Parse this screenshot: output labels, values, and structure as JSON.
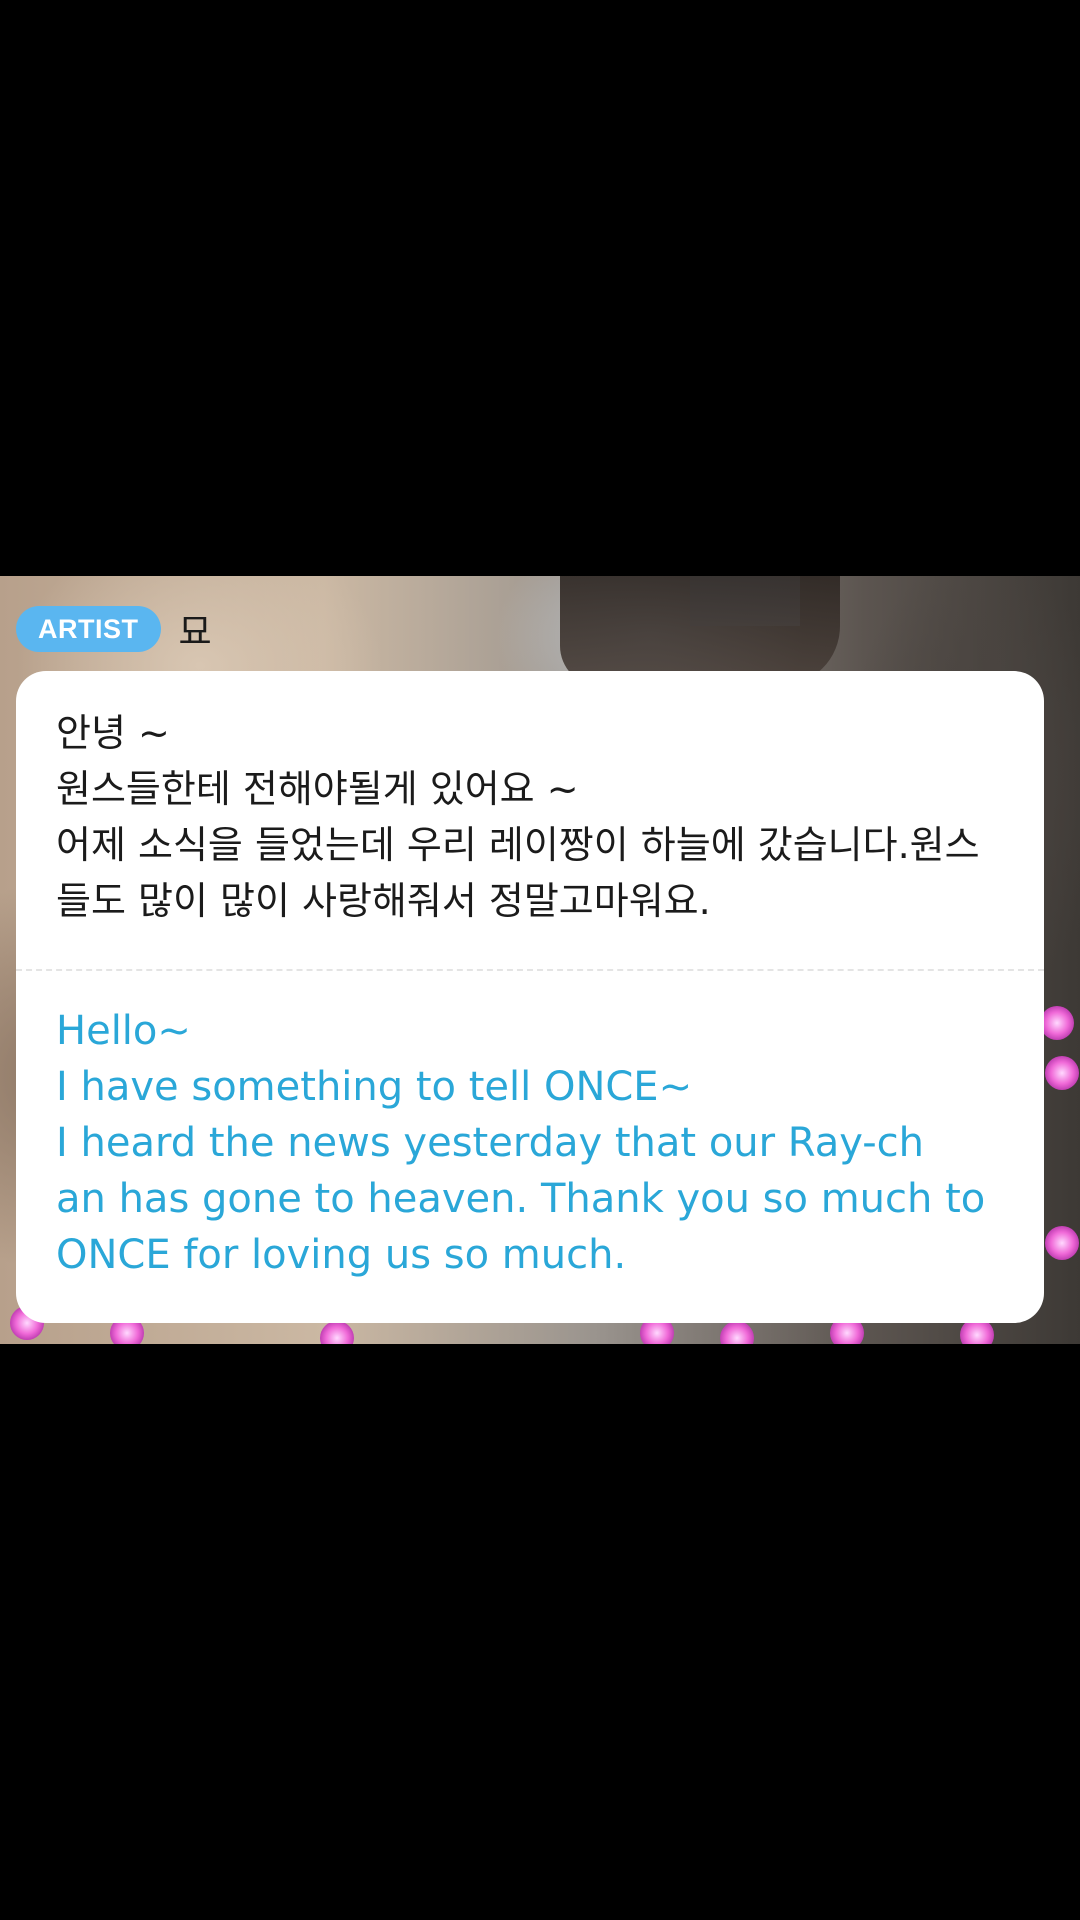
{
  "post": {
    "badge": "ARTIST",
    "author": "묘"
  },
  "message": {
    "korean_lines": [
      "안녕 ~",
      "원스들한테 전해야될게 있어요 ~",
      "어제 소식을 들었는데 우리 레이짱이 하늘에 갔습니다.원스",
      "들도 많이 많이 사랑해줘서 정말고마워요."
    ],
    "english_lines": [
      "Hello~",
      "I have something to tell ONCE~",
      "I heard the news yesterday that our Ray-ch",
      "an has gone to heaven. Thank you so much to",
      "ONCE for loving us so much."
    ]
  },
  "colors": {
    "badge": "#5ab6f0",
    "korean_text": "#1b1b1b",
    "english_text": "#2aa7d8",
    "card": "#ffffff",
    "letterbox": "#000000"
  }
}
